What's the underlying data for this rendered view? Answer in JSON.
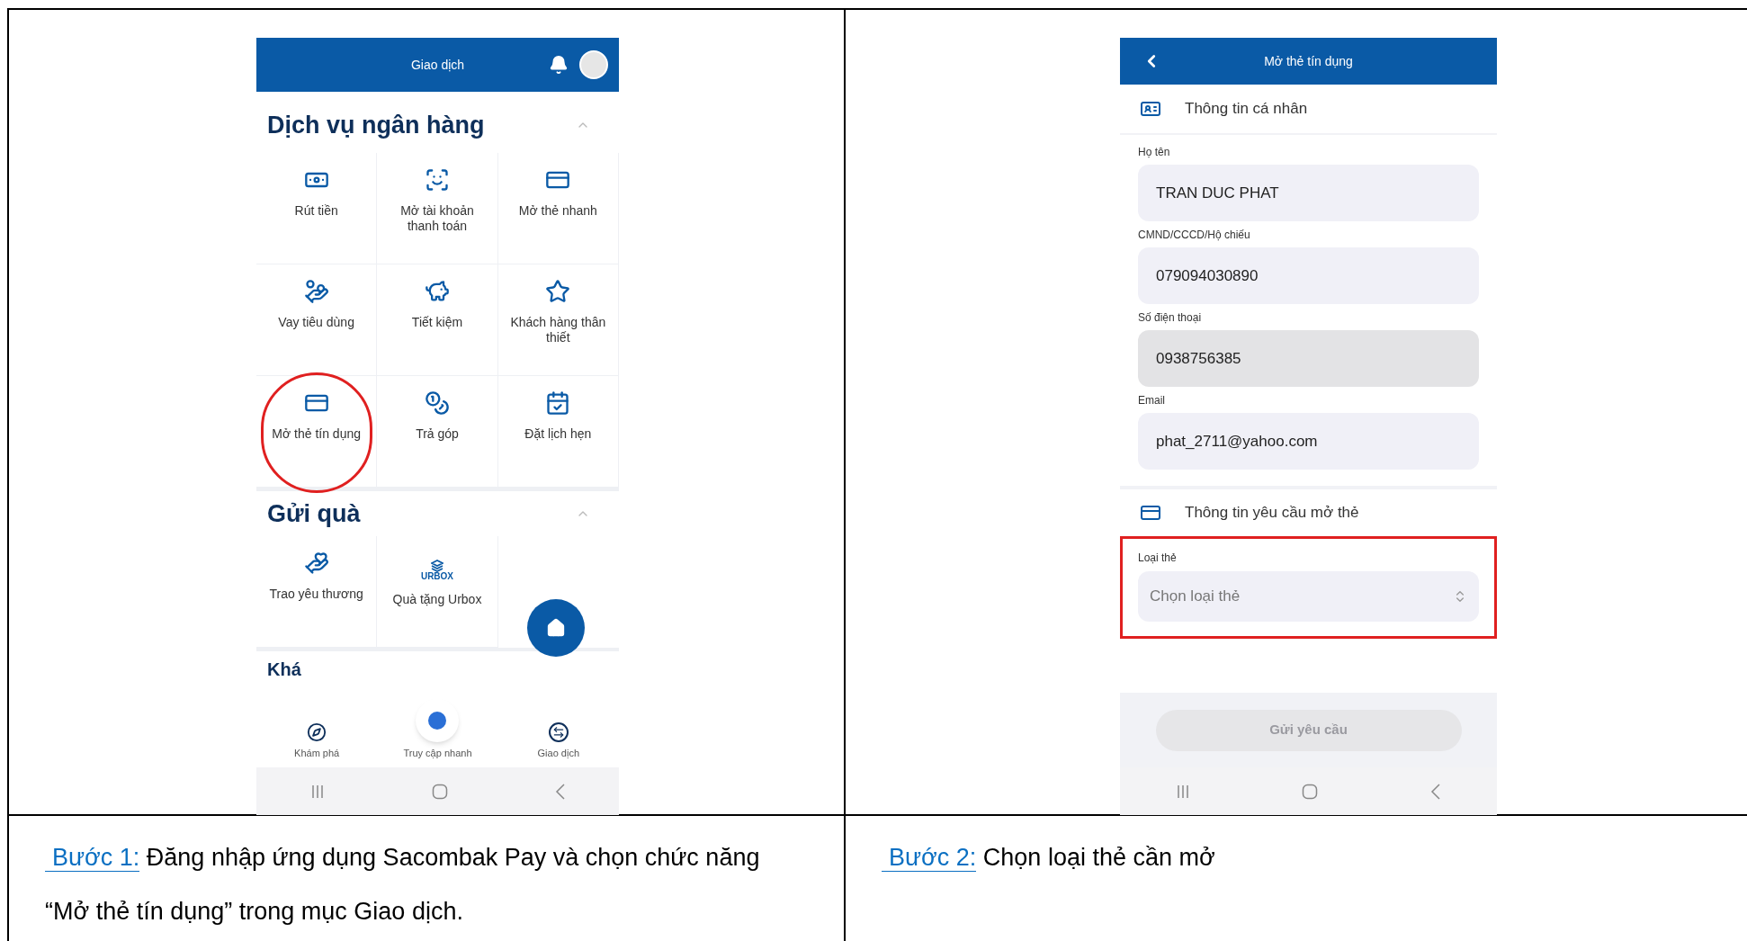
{
  "left_screen": {
    "header_title": "Giao dịch",
    "sections": [
      {
        "title": "Dịch vụ ngân hàng",
        "expanded": true,
        "tiles": [
          {
            "label": "Rút tiền",
            "circled": false
          },
          {
            "label": "Mở tài khoản thanh toán",
            "circled": false
          },
          {
            "label": "Mở thẻ nhanh",
            "circled": false
          },
          {
            "label": "Vay tiêu dùng",
            "circled": false
          },
          {
            "label": "Tiết kiệm",
            "circled": false
          },
          {
            "label": "Khách hàng thân thiết",
            "circled": false
          },
          {
            "label": "Mở thẻ tín dụng",
            "circled": true
          },
          {
            "label": "Trả góp",
            "circled": false
          },
          {
            "label": "Đặt lịch hẹn",
            "circled": false
          }
        ]
      },
      {
        "title": "Gửi quà",
        "expanded": true,
        "tiles": [
          {
            "label": "Trao yêu thương",
            "circled": false
          },
          {
            "label": "Quà tặng Urbox",
            "logo_text": "URBOX",
            "circled": false
          }
        ]
      }
    ],
    "partial_section_title": "Khá",
    "bottom_nav": [
      {
        "label": "Khám phá",
        "kind": "explore"
      },
      {
        "label": "Truy cập nhanh",
        "kind": "quick"
      },
      {
        "label": "Giao dịch",
        "kind": "transactions"
      }
    ]
  },
  "right_screen": {
    "header_title": "Mở thẻ tín dụng",
    "personal_section": {
      "title": "Thông tin cá nhân",
      "fields": [
        {
          "label": "Họ tên",
          "value": "TRAN DUC PHAT",
          "disabled": false
        },
        {
          "label": "CMND/CCCD/Hộ chiếu",
          "value": "079094030890",
          "disabled": false
        },
        {
          "label": "Số điện thoại",
          "value": "0938756385",
          "disabled": true
        },
        {
          "label": "Email",
          "value": "phat_2711@yahoo.com",
          "disabled": false
        }
      ]
    },
    "request_section": {
      "title": "Thông tin yêu cầu mở thẻ",
      "field": {
        "label": "Loại thẻ",
        "placeholder": "Chọn loại thẻ",
        "highlighted": true
      }
    },
    "submit_button": {
      "label": "Gửi yêu cầu",
      "disabled": true
    }
  },
  "captions": [
    {
      "step": "Bước 1:",
      "text": "Đăng nhập ứng dụng Sacombak Pay và chọn chức năng “Mở thẻ tín dụng” trong mục Giao dịch."
    },
    {
      "step": "Bước 2:",
      "text": "Chọn loại thẻ cần mở"
    }
  ]
}
